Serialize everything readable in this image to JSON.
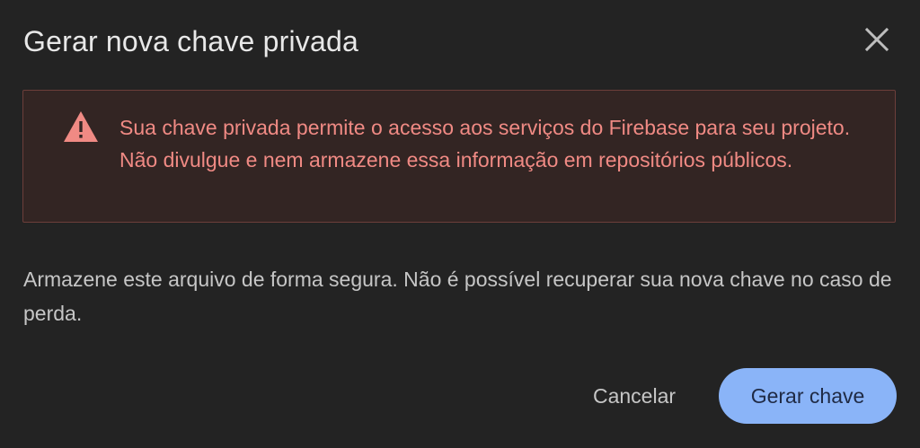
{
  "dialog": {
    "title": "Gerar nova chave privada",
    "close_icon": "close-icon",
    "warning": {
      "icon": "warning-triangle-icon",
      "text": "Sua chave privada permite o acesso aos serviços do Firebase para seu projeto. Não divulgue e nem armazene essa informação em repositórios públicos."
    },
    "body": "Armazene este arquivo de forma segura. Não é possível recuperar sua nova chave no caso de perda.",
    "actions": {
      "cancel_label": "Cancelar",
      "primary_label": "Gerar chave"
    }
  },
  "colors": {
    "background": "#232323",
    "warning_background": "#332523",
    "warning_border": "#6c3e3a",
    "warning_text": "#f08a84",
    "primary_button": "#8ab4f8"
  }
}
